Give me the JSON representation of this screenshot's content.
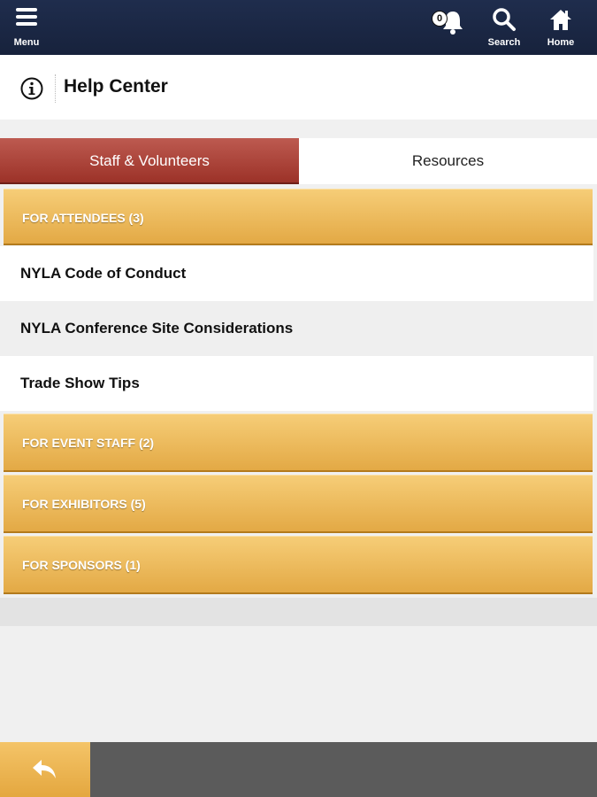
{
  "nav": {
    "menu_label": "Menu",
    "notification_count": "0",
    "search_label": "Search",
    "home_label": "Home"
  },
  "header": {
    "title": "Help Center",
    "icon": "info-icon"
  },
  "tabs": [
    {
      "label": "Staff & Volunteers",
      "active": true
    },
    {
      "label": "Resources",
      "active": false
    }
  ],
  "groups": [
    {
      "label": "FOR ATTENDEES (3)",
      "expanded": true,
      "items": [
        {
          "label": "NYLA Code of Conduct"
        },
        {
          "label": "NYLA Conference Site Considerations"
        },
        {
          "label": "Trade Show Tips"
        }
      ]
    },
    {
      "label": "FOR EVENT STAFF (2)",
      "expanded": false
    },
    {
      "label": "FOR EXHIBITORS (5)",
      "expanded": false
    },
    {
      "label": "FOR SPONSORS (1)",
      "expanded": false
    }
  ],
  "footer": {
    "back_icon": "back-arrow-icon"
  },
  "colors": {
    "nav_bg": "#1c2946",
    "tab_active": "#a93d33",
    "group_header": "#ebb656",
    "footer_bg": "#5b5b5b"
  }
}
